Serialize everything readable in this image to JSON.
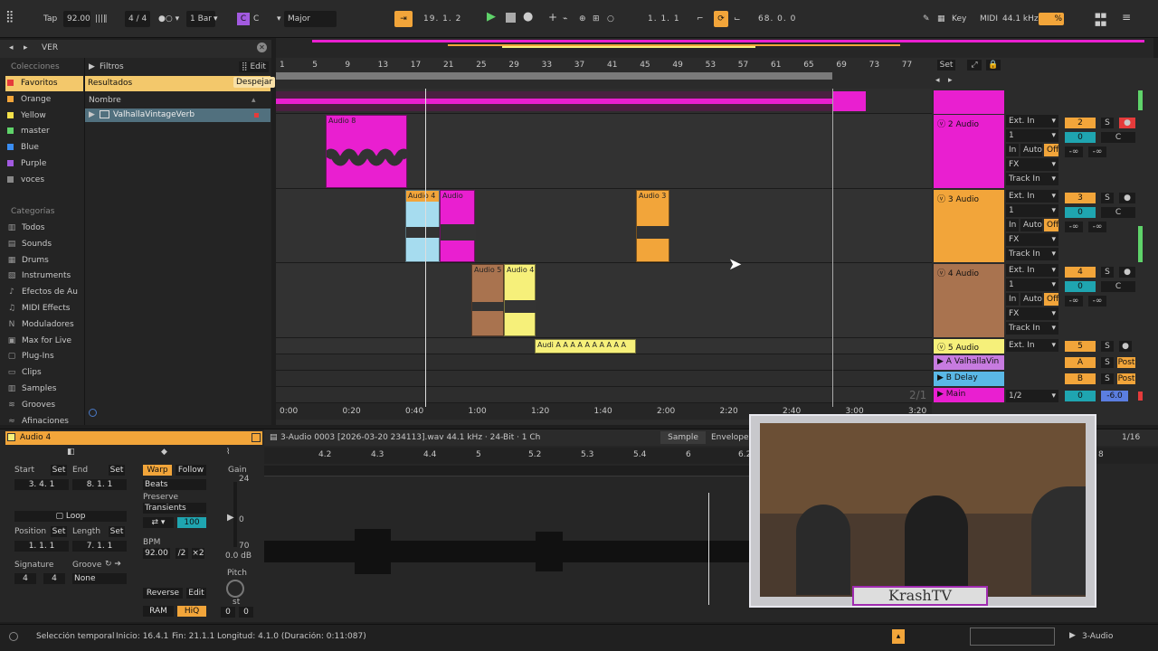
{
  "topbar": {
    "tap": "Tap",
    "tempo": "92.00",
    "signature": "4 / 4",
    "quantize": "1 Bar",
    "key_letter": "C",
    "key_root": "C",
    "key_scale": "Major",
    "position": "19.  1.  2",
    "loop_start": "1.  1.  1",
    "loop_length": "68.  0.  0",
    "key_label": "Key",
    "midi_label": "MIDI",
    "sample_rate": "44.1 kHz",
    "cpu": "%"
  },
  "browser": {
    "search": "VER",
    "collections_title": "Colecciones",
    "collections": [
      {
        "label": "Favoritos",
        "color": "#e53b3b"
      },
      {
        "label": "Orange",
        "color": "#f2a53a"
      },
      {
        "label": "Yellow",
        "color": "#f3e14a"
      },
      {
        "label": "master",
        "color": "#5fd36a"
      },
      {
        "label": "Blue",
        "color": "#3a8df2"
      },
      {
        "label": "Purple",
        "color": "#a25ae0"
      },
      {
        "label": "voces",
        "color": "#888888"
      }
    ],
    "categories_title": "Categorías",
    "categories": [
      "Todos",
      "Sounds",
      "Drums",
      "Instruments",
      "Efectos de Au",
      "MIDI Effects",
      "Moduladores",
      "Max for Live",
      "Plug-Ins",
      "Clips",
      "Samples",
      "Grooves",
      "Afinaciones"
    ],
    "filters": "Filtros",
    "edit": "Edit",
    "results": "Resultados",
    "clear": "Despejar",
    "name_col": "Nombre",
    "result_item": "ValhallaVintageVerb"
  },
  "ruler": {
    "bars": [
      "1",
      "5",
      "9",
      "13",
      "17",
      "21",
      "25",
      "29",
      "33",
      "37",
      "41",
      "45",
      "49",
      "53",
      "57",
      "61",
      "65",
      "69",
      "73",
      "77"
    ],
    "set": "Set"
  },
  "time_ruler": [
    "0:00",
    "0:20",
    "0:40",
    "1:00",
    "1:20",
    "1:40",
    "2:00",
    "2:20",
    "2:40",
    "3:00",
    "3:20"
  ],
  "clips": {
    "audio8": "Audio 8",
    "audio4a": "Audio 4",
    "audio": "Audio",
    "audio3": "Audio 3",
    "audio5": "Audio 5",
    "audio4b": "Audio 4",
    "small": "Audi A A A A A A A A A A"
  },
  "tracks": [
    {
      "name": "Main",
      "input": "",
      "num": ""
    },
    {
      "name": "2 Audio",
      "input": "Ext. In",
      "ch": "1",
      "num": "2",
      "vol": "0",
      "pan": "C"
    },
    {
      "name": "3 Audio",
      "input": "Ext. In",
      "ch": "1",
      "num": "3",
      "vol": "0",
      "pan": "C"
    },
    {
      "name": "4 Audio",
      "input": "Ext. In",
      "ch": "1",
      "num": "4",
      "vol": "0",
      "pan": "C"
    },
    {
      "name": "5 Audio",
      "input": "Ext. In",
      "num": "5"
    },
    {
      "name": "A ValhallaVin",
      "num": "A",
      "post": "Post"
    },
    {
      "name": "B Delay",
      "num": "B",
      "post": "Post"
    },
    {
      "name": "Main",
      "input": "1/2",
      "vol": "0",
      "db": "-6.0"
    }
  ],
  "mixer_common": {
    "in": "In",
    "auto": "Auto",
    "off": "Off",
    "inf": "-∞",
    "fx": "FX",
    "track_in": "Track In",
    "solo": "S"
  },
  "ratio": "2/1",
  "detail": {
    "clip_name": "Audio 4",
    "file": "3-Audio 0003 [2026-03-20 234113].wav  44.1 kHz · 24-Bit · 1 Ch",
    "sample_tab": "Sample",
    "envelope_tab": "Envelope",
    "grid": "1/16",
    "start": "Start",
    "set": "Set",
    "end": "End",
    "start_val": "3.  4.  1",
    "end_val": "8.  1.  1",
    "loop": "Loop",
    "position": "Position",
    "length": "Length",
    "pos_val": "1.  1.  1",
    "len_val": "7.  1.  1",
    "signature": "Signature",
    "groove": "Groove",
    "sig_num": "4",
    "sig_den": "4",
    "groove_val": "None",
    "warp": "Warp",
    "follow": "Follow",
    "beats": "Beats",
    "preserve": "Preserve",
    "transients": "Transients",
    "hundred": "100",
    "bpm": "BPM",
    "bpm_val": "92.00",
    "half": "/2",
    "double": "×2",
    "reverse": "Reverse",
    "edit": "Edit",
    "ram": "RAM",
    "hiq": "HiQ",
    "gain": "Gain",
    "g24": "24",
    "g0": "0",
    "g70": "70",
    "gdb": "0.0 dB",
    "pitch": "Pitch",
    "st": "st",
    "p0a": "0",
    "p0b": "0",
    "ruler": [
      "4.2",
      "4.3",
      "4.4",
      "5",
      "5.2",
      "5.3",
      "5.4",
      "6",
      "6.2",
      "8"
    ]
  },
  "status": {
    "mode": "Selección temporal",
    "start": "Inicio: 16.4.1",
    "end": "Fin: 21.1.1",
    "length": "Longitud: 4.1.0 (Duración: 0:11:087)",
    "track": "3-Audio"
  },
  "webcam": {
    "logo": "KrashTV"
  },
  "colors": {
    "pink": "#e91fd0",
    "orange": "#f2a53a",
    "brown": "#a9734f",
    "yellow": "#f6f07a",
    "lightblue": "#a6dcef",
    "accent": "#f2a53a"
  }
}
